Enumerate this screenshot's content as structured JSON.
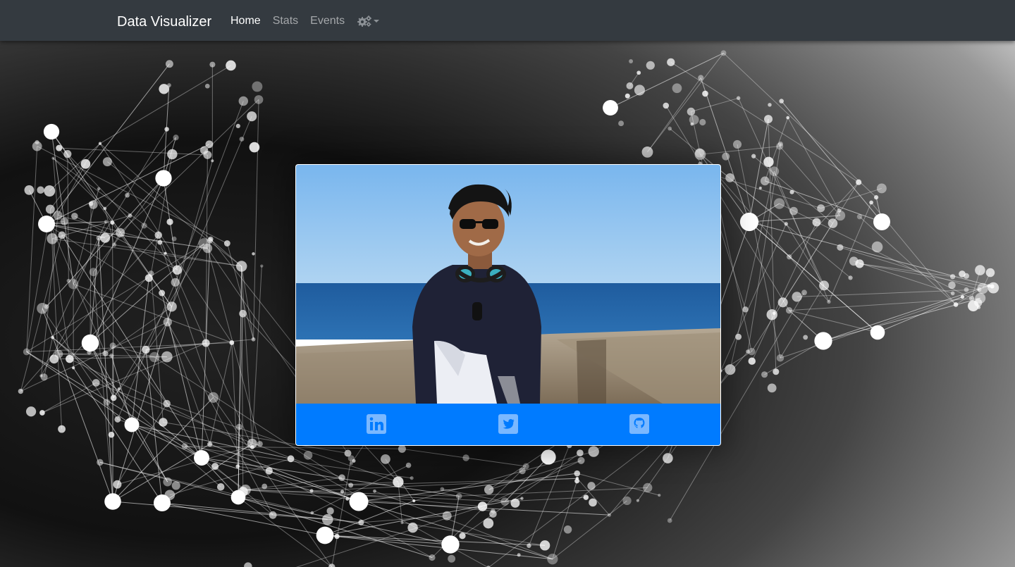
{
  "navbar": {
    "brand": "Data Visualizer",
    "links": [
      {
        "label": "Home",
        "active": true
      },
      {
        "label": "Stats",
        "active": false
      },
      {
        "label": "Events",
        "active": false
      }
    ],
    "settings_icon": "gears-icon",
    "dropdown_icon": "caret-down-icon"
  },
  "profile_card": {
    "photo_alt": "",
    "social_links": [
      {
        "icon": "linkedin-icon"
      },
      {
        "icon": "twitter-icon"
      },
      {
        "icon": "github-icon"
      }
    ]
  },
  "colors": {
    "navbar_bg": "#343a40",
    "accent": "#007bff",
    "icon": "#7ab8ff"
  }
}
